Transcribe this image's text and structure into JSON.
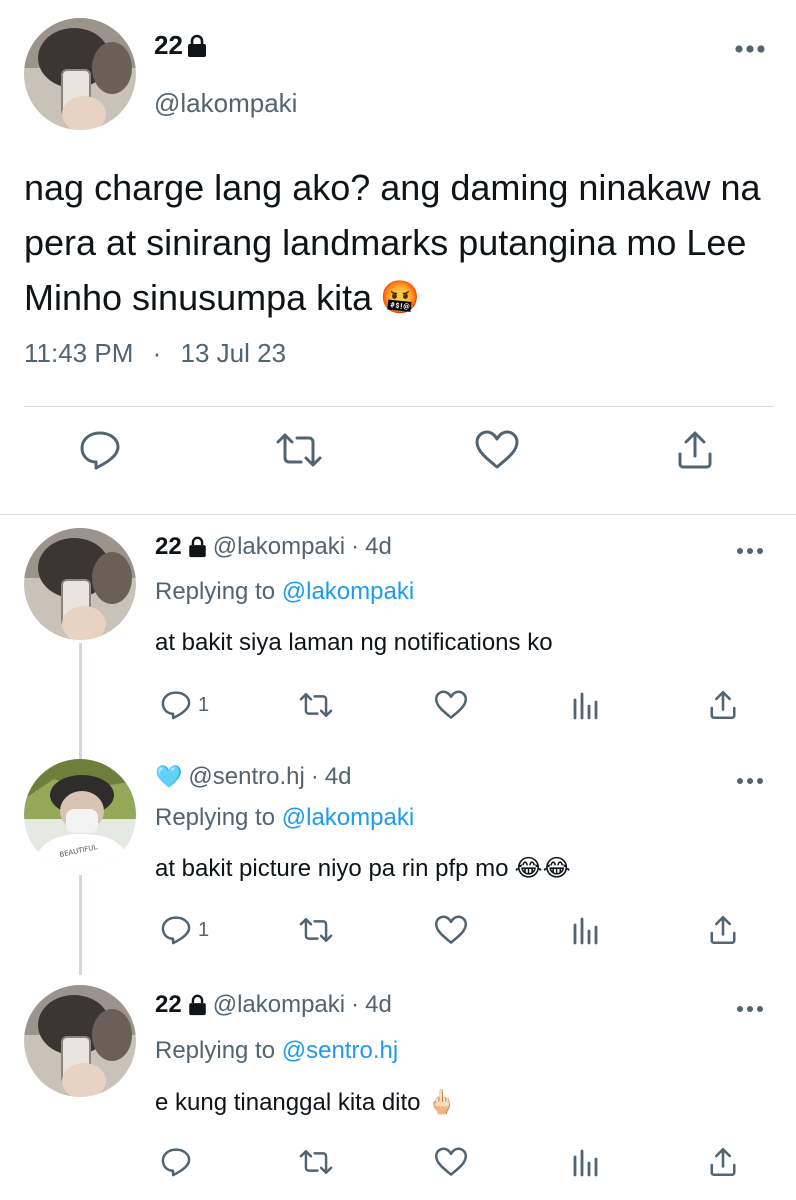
{
  "main_tweet": {
    "display_name": "22",
    "handle": "@lakompaki",
    "text_lines": [
      "nag charge lang ako? ang daming ninakaw na",
      "pera at sinirang landmarks putangina mo Lee",
      "Minho sinusumpa kita"
    ],
    "emoji": "🤬",
    "time": "11:43 PM",
    "separator": "·",
    "date": "13 Jul 23",
    "actions": [
      "reply-icon",
      "retweet-icon",
      "like-icon",
      "share-icon"
    ]
  },
  "replies": [
    {
      "display_name": "22",
      "handle": "@lakompaki",
      "age": "4d",
      "dot": "·",
      "replying_prefix": "Replying to",
      "replying_to": "@lakompaki",
      "text": "at bakit siya laman ng notifications ko",
      "emoji": "",
      "reply_count": "1"
    },
    {
      "display_name": "🩵",
      "handle": "@sentro.hj",
      "age": "4d",
      "dot": "·",
      "replying_prefix": "Replying to",
      "replying_to": "@lakompaki",
      "text": "at bakit picture niyo pa rin pfp mo",
      "emoji": "😂😂",
      "reply_count": "1"
    },
    {
      "display_name": "22",
      "handle": "@lakompaki",
      "age": "4d",
      "dot": "·",
      "replying_prefix": "Replying to",
      "replying_to": "@sentro.hj",
      "text": "e kung tinanggal kita dito",
      "emoji": "🖕🏻",
      "reply_count": ""
    }
  ],
  "colors": {
    "text": "#0f1419",
    "secondary": "#536471",
    "accent": "#1d9bf0",
    "divider": "#d8dee3"
  }
}
